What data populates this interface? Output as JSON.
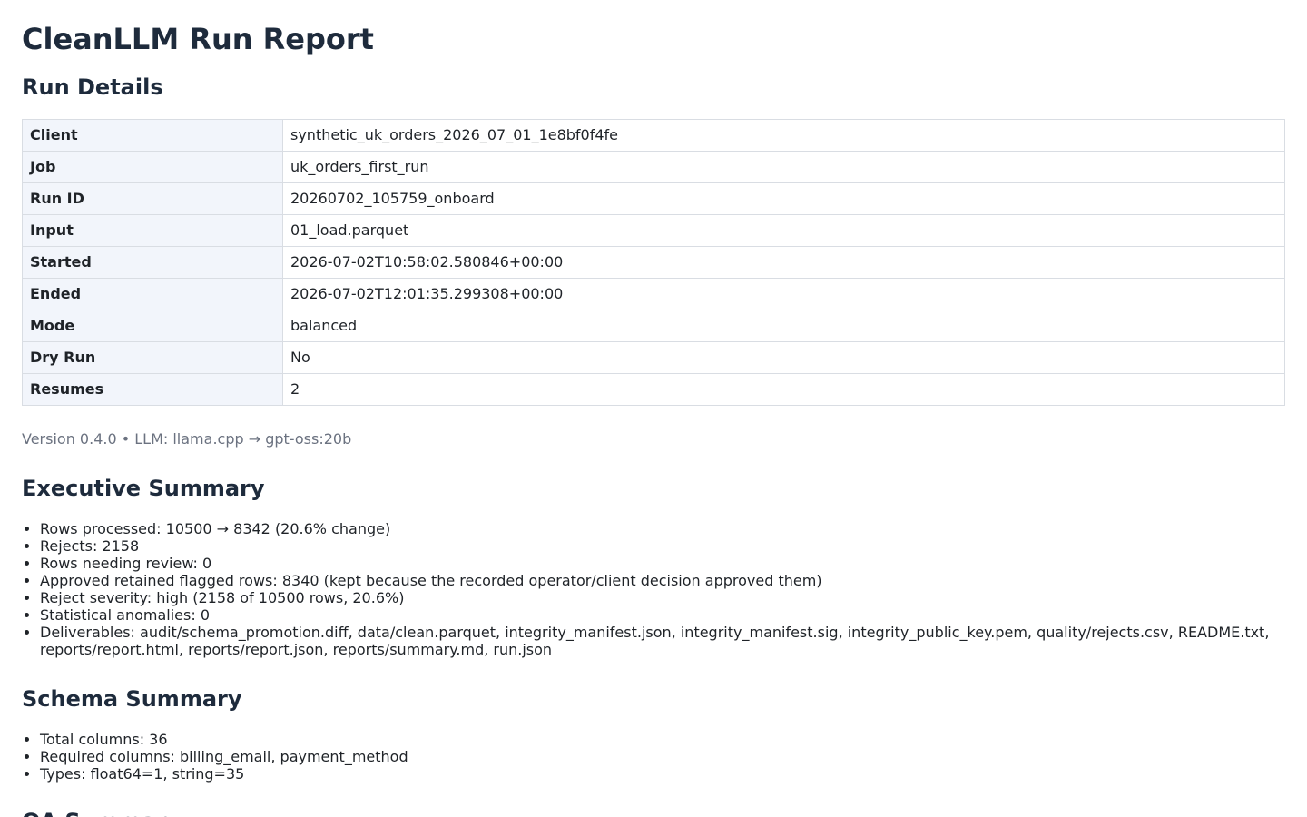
{
  "title": "CleanLLM Run Report",
  "run_details": {
    "heading": "Run Details",
    "rows": [
      {
        "key": "Client",
        "value": "synthetic_uk_orders_2026_07_01_1e8bf0f4fe"
      },
      {
        "key": "Job",
        "value": "uk_orders_first_run"
      },
      {
        "key": "Run ID",
        "value": "20260702_105759_onboard"
      },
      {
        "key": "Input",
        "value": "01_load.parquet"
      },
      {
        "key": "Started",
        "value": "2026-07-02T10:58:02.580846+00:00"
      },
      {
        "key": "Ended",
        "value": "2026-07-02T12:01:35.299308+00:00"
      },
      {
        "key": "Mode",
        "value": "balanced"
      },
      {
        "key": "Dry Run",
        "value": "No"
      },
      {
        "key": "Resumes",
        "value": "2"
      }
    ],
    "meta": "Version 0.4.0 • LLM: llama.cpp → gpt-oss:20b"
  },
  "executive_summary": {
    "heading": "Executive Summary",
    "items": [
      "Rows processed: 10500 → 8342 (20.6% change)",
      "Rejects: 2158",
      "Rows needing review: 0",
      "Approved retained flagged rows: 8340 (kept because the recorded operator/client decision approved them)",
      "Reject severity: high (2158 of 10500 rows, 20.6%)",
      "Statistical anomalies: 0",
      "Deliverables: audit/schema_promotion.diff, data/clean.parquet, integrity_manifest.json, integrity_manifest.sig, integrity_public_key.pem, quality/rejects.csv, README.txt, reports/report.html, reports/report.json, reports/summary.md, run.json"
    ]
  },
  "schema_summary": {
    "heading": "Schema Summary",
    "items": [
      "Total columns: 36",
      "Required columns: billing_email, payment_method",
      "Types: float64=1, string=35"
    ]
  },
  "qa": {
    "heading": "QA Summary"
  }
}
